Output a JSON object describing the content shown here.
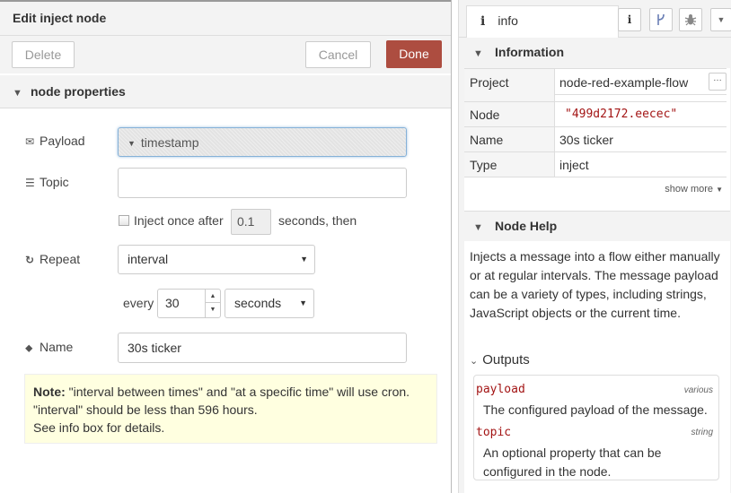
{
  "tray": {
    "title": "Edit inject node",
    "delete_label": "Delete",
    "cancel_label": "Cancel",
    "done_label": "Done",
    "section_title": "node properties",
    "payload": {
      "label": "Payload",
      "value": "timestamp"
    },
    "topic": {
      "label": "Topic",
      "value": ""
    },
    "inject_once": {
      "label": "Inject once after",
      "delay": "0.1",
      "suffix": "seconds, then",
      "checked": false
    },
    "repeat": {
      "label": "Repeat",
      "value": "interval",
      "every_label": "every",
      "every_value": "30",
      "unit": "seconds"
    },
    "name": {
      "label": "Name",
      "value": "30s ticker"
    },
    "note": {
      "bold": "Note:",
      "line1": " \"interval between times\" and \"at a specific time\" will use cron.",
      "line2": "\"interval\" should be less than 596 hours.",
      "line3": "See info box for details."
    }
  },
  "sidebar": {
    "tab_icon": "i",
    "tab_label": "info",
    "info_section": "Information",
    "rows": {
      "project": {
        "key": "Project",
        "value": "node-red-example-flow"
      },
      "node": {
        "key": "Node",
        "value": "\"499d2172.eecec\""
      },
      "name": {
        "key": "Name",
        "value": "30s ticker"
      },
      "type": {
        "key": "Type",
        "value": "inject"
      }
    },
    "show_more": "show more",
    "help_section": "Node Help",
    "help_text": "Injects a message into a flow either manually or at regular intervals. The message payload can be a variety of types, including strings, JavaScript objects or the current time.",
    "outputs_title": "Outputs",
    "outputs": [
      {
        "name": "payload",
        "type": "various",
        "desc": "The configured payload of the message."
      },
      {
        "name": "topic",
        "type": "string",
        "desc": "An optional property that can be configured in the node."
      }
    ]
  },
  "icons": {
    "envelope": "envelope-icon",
    "tasks": "list-icon",
    "refresh": "refresh-icon",
    "tag": "tag-icon"
  }
}
